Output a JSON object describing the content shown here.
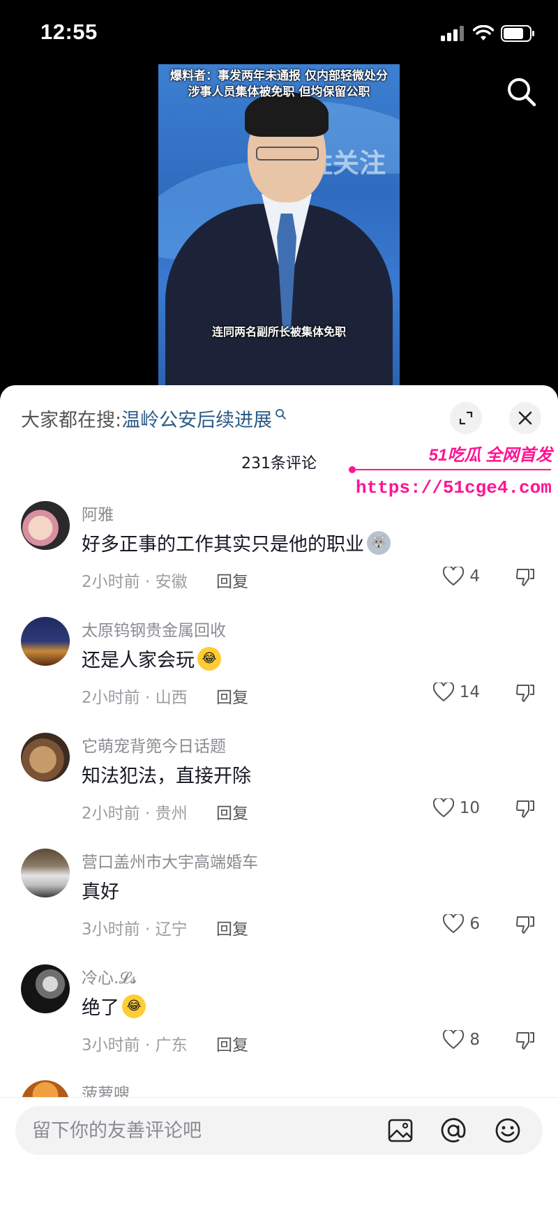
{
  "status_bar": {
    "time": "12:55"
  },
  "video": {
    "caption_top_line1": "爆料者：事发两年未通报 仅内部轻微处分",
    "caption_top_line2": "涉事人员集体被免职 但均保留公职",
    "watermark": "百姓关注",
    "caption_bottom": "连同两名副所长被集体免职"
  },
  "sheet": {
    "search_prefix": "大家都在搜:",
    "search_term": "温岭公安后续进展",
    "comment_count": "231条评论"
  },
  "promo": {
    "title": "51吃瓜 全网首发",
    "url": "https://51cge4.com"
  },
  "comments": [
    {
      "user": "阿雅",
      "text": "好多正事的工作其实只是他的职业",
      "emoji": "dog-emoji",
      "time": "2小时前",
      "region": "安徽",
      "likes": "4"
    },
    {
      "user": "太原钨钢贵金属回收",
      "text": "还是人家会玩",
      "emoji": "laugh-cry-emoji",
      "time": "2小时前",
      "region": "山西",
      "likes": "14"
    },
    {
      "user": "它萌宠背篼今日话题",
      "text": "知法犯法，直接开除",
      "emoji": "",
      "time": "2小时前",
      "region": "贵州",
      "likes": "10"
    },
    {
      "user": "营口盖州市大宇高端婚车",
      "text": "真好",
      "emoji": "",
      "time": "3小时前",
      "region": "辽宁",
      "likes": "6"
    },
    {
      "user": "冷心.𝓛𝓼",
      "text": "绝了",
      "emoji": "laugh-cry-emoji",
      "time": "3小时前",
      "region": "广东",
      "likes": "8"
    },
    {
      "user": "菠萝嗖"
    }
  ],
  "labels": {
    "reply": "回复",
    "separator": " · "
  },
  "input": {
    "placeholder": "留下你的友善评论吧"
  }
}
